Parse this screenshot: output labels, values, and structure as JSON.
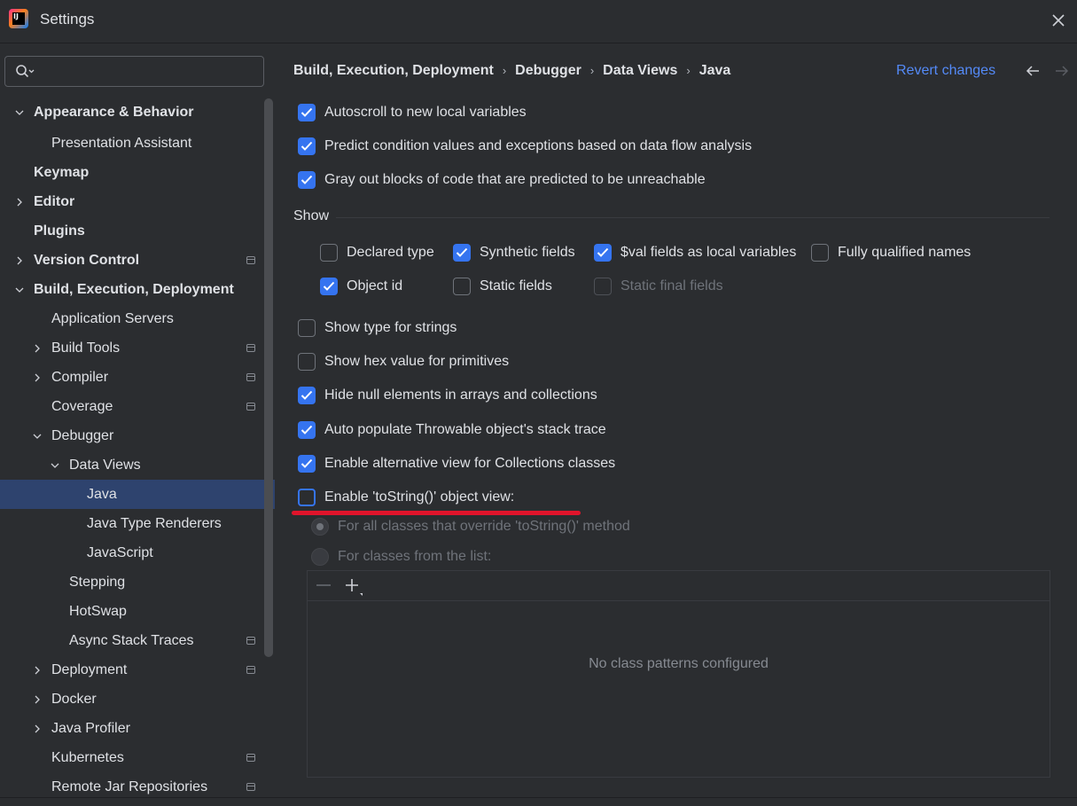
{
  "window": {
    "title": "Settings",
    "logo_text": "IJ"
  },
  "search": {
    "value": "",
    "placeholder": ""
  },
  "sidebar": {
    "items": [
      {
        "label": "Appearance & Behavior",
        "bold": true,
        "expanded": true
      },
      {
        "label": "Presentation Assistant"
      },
      {
        "label": "Keymap",
        "bold": true
      },
      {
        "label": "Editor",
        "bold": true,
        "collapsed": true
      },
      {
        "label": "Plugins",
        "bold": true
      },
      {
        "label": "Version Control",
        "bold": true,
        "collapsed": true,
        "project_mark": true
      },
      {
        "label": "Build, Execution, Deployment",
        "bold": true,
        "expanded": true
      },
      {
        "label": "Application Servers"
      },
      {
        "label": "Build Tools",
        "collapsed": true,
        "project_mark": true
      },
      {
        "label": "Compiler",
        "collapsed": true,
        "project_mark": true
      },
      {
        "label": "Coverage",
        "project_mark": true
      },
      {
        "label": "Debugger",
        "expanded": true
      },
      {
        "label": "Data Views",
        "expanded": true
      },
      {
        "label": "Java",
        "selected": true
      },
      {
        "label": "Java Type Renderers"
      },
      {
        "label": "JavaScript"
      },
      {
        "label": "Stepping"
      },
      {
        "label": "HotSwap"
      },
      {
        "label": "Async Stack Traces",
        "project_mark": true
      },
      {
        "label": "Deployment",
        "collapsed": true,
        "project_mark": true
      },
      {
        "label": "Docker",
        "collapsed": true
      },
      {
        "label": "Java Profiler",
        "collapsed": true
      },
      {
        "label": "Kubernetes",
        "project_mark": true
      },
      {
        "label": "Remote Jar Repositories",
        "project_mark": true
      }
    ]
  },
  "breadcrumb": [
    "Build, Execution, Deployment",
    "Debugger",
    "Data Views",
    "Java"
  ],
  "header": {
    "revert_label": "Revert changes"
  },
  "options": {
    "autoscroll": {
      "label": "Autoscroll to new local variables",
      "checked": true
    },
    "predict": {
      "label": "Predict condition values and exceptions based on data flow analysis",
      "checked": true
    },
    "gray_out": {
      "label": "Gray out blocks of code that are predicted to be unreachable",
      "checked": true
    }
  },
  "show_section": {
    "title": "Show",
    "declared_type": {
      "label": "Declared type",
      "checked": false
    },
    "synthetic_fields": {
      "label": "Synthetic fields",
      "checked": true
    },
    "val_fields": {
      "label": "$val fields as local variables",
      "checked": true
    },
    "fully_qualified": {
      "label": "Fully qualified names",
      "checked": false
    },
    "object_id": {
      "label": "Object id",
      "checked": true
    },
    "static_fields": {
      "label": "Static fields",
      "checked": false
    },
    "static_final_fields": {
      "label": "Static final fields",
      "checked": false,
      "disabled": true
    }
  },
  "more_options": {
    "type_strings": {
      "label": "Show type for strings",
      "checked": false
    },
    "hex_value": {
      "label": "Show hex value for primitives",
      "checked": false
    },
    "hide_null": {
      "label": "Hide null elements in arrays and collections",
      "checked": true
    },
    "auto_populate": {
      "label": "Auto populate Throwable object's stack trace",
      "checked": true
    },
    "alt_view": {
      "label": "Enable alternative view for Collections classes",
      "checked": true
    },
    "tostring_view": {
      "label": "Enable 'toString()' object view:",
      "checked": false
    }
  },
  "tostring_radios": {
    "all_classes": {
      "label": "For all classes that override 'toString()' method",
      "selected": true,
      "disabled": true
    },
    "from_list": {
      "label": "For classes from the list:",
      "selected": false,
      "disabled": true
    }
  },
  "patterns_table": {
    "empty_text": "No class patterns configured"
  },
  "colors": {
    "accent": "#3574f0",
    "link": "#548af7",
    "selected_row": "#2e436e",
    "annotation": "#e0142b"
  }
}
